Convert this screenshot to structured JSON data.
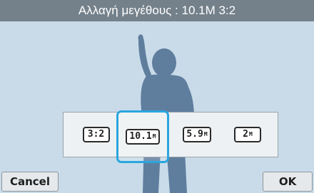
{
  "header": {
    "title": "Αλλαγή μεγέθους : 10.1M 3:2"
  },
  "options": [
    {
      "value": "3:2",
      "unit": ""
    },
    {
      "value": "10.1",
      "unit": "M"
    },
    {
      "value": "5.9",
      "unit": "M"
    },
    {
      "value": "2",
      "unit": "M"
    }
  ],
  "selected_index": 1,
  "buttons": {
    "cancel": "Cancel",
    "ok": "OK"
  },
  "colors": {
    "background": "#c9dbe9",
    "title_bar": "#74818b",
    "selection": "#2aa6df",
    "silhouette": "#5f7e9e"
  },
  "icons": {
    "background_image": "child-silhouette-icon"
  }
}
